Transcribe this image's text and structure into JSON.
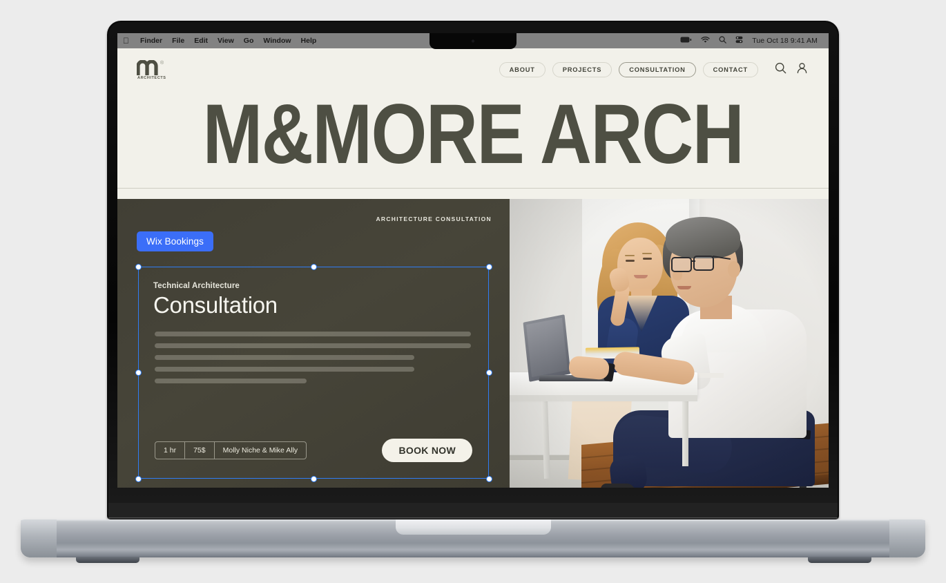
{
  "os": {
    "menubar": {
      "apple_icon": "apple-logo-icon",
      "items": [
        "Finder",
        "File",
        "Edit",
        "View",
        "Go",
        "Window",
        "Help"
      ],
      "status_icons": [
        "battery-icon",
        "wifi-icon",
        "search-icon",
        "control-center-icon"
      ],
      "clock": "Tue Oct 18  9:41 AM"
    }
  },
  "site": {
    "brand": {
      "mark": "M",
      "registered": "®",
      "subtitle": "ARCHITECTS"
    },
    "nav": {
      "items": [
        {
          "label": "ABOUT",
          "active": false
        },
        {
          "label": "PROJECTS",
          "active": false
        },
        {
          "label": "CONSULTATION",
          "active": true
        },
        {
          "label": "CONTACT",
          "active": false
        }
      ],
      "icons": [
        "search-icon",
        "account-icon"
      ]
    },
    "hero": {
      "title": "M&MORE ARCH"
    },
    "section": {
      "eyebrow": "ARCHITECTURE CONSULTATION",
      "editor_badge": "Wix Bookings",
      "card": {
        "kicker": "Technical Architecture",
        "title": "Consultation",
        "description_placeholder_widths": [
          100,
          100,
          82,
          82,
          48
        ],
        "meta": [
          {
            "label": "1 hr"
          },
          {
            "label": "75$"
          },
          {
            "label": "Molly Niche & Mike Ally"
          }
        ],
        "cta": "BOOK NOW"
      },
      "photo_alt": "Two people reviewing plans on a laptop at a white desk"
    }
  },
  "colors": {
    "page_cream": "#f2f1ea",
    "olive_dark": "#3d3d34",
    "olive_text": "#4e4f43",
    "selection_blue": "#2f7df6",
    "badge_blue": "#3b6ef8",
    "cta_cream": "#f4f2e9"
  }
}
